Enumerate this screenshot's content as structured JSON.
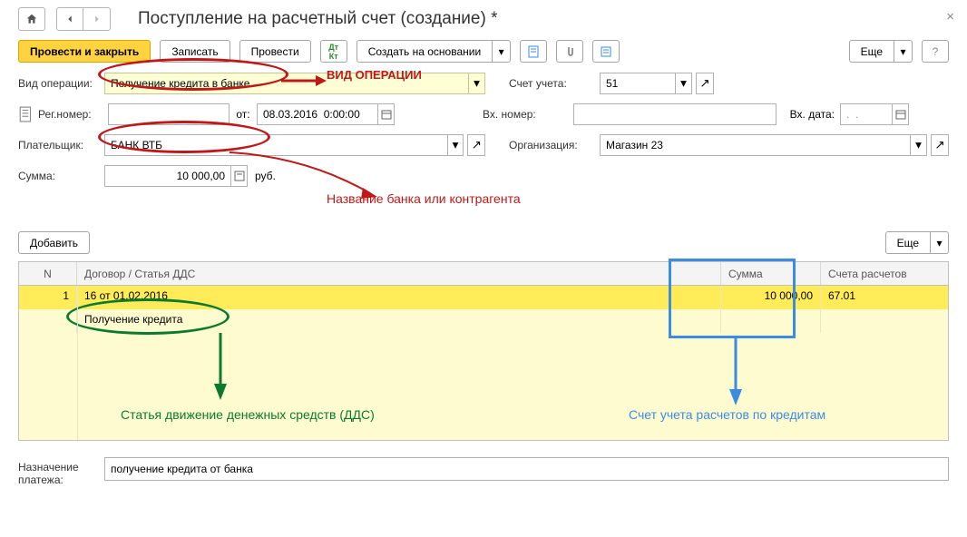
{
  "title": "Поступление на расчетный счет (создание) *",
  "actions": {
    "main": "Провести и закрыть",
    "save": "Записать",
    "post": "Провести",
    "create_based": "Создать на основании",
    "more": "Еще",
    "add": "Добавить"
  },
  "labels": {
    "operation_type": "Вид операции:",
    "account": "Счет учета:",
    "reg_number": "Рег.номер:",
    "from": "от:",
    "in_number": "Вх. номер:",
    "in_date": "Вх. дата:",
    "payer": "Плательщик:",
    "organization": "Организация:",
    "amount": "Сумма:",
    "currency": "руб.",
    "purpose": "Назначение платежа:"
  },
  "fields": {
    "operation_type": "Получение кредита в банке",
    "account": "51",
    "reg_number": "",
    "date": "08.03.2016  0:00:00",
    "in_number": "",
    "in_date": ".  .",
    "payer": "БАНК ВТБ",
    "organization": "Магазин 23",
    "amount": "10 000,00",
    "purpose": "получение кредита от банка"
  },
  "grid": {
    "headers": {
      "n": "N",
      "contract": "Договор / Статья ДДС",
      "sum": "Сумма",
      "accounts": "Счета расчетов"
    },
    "rows": [
      {
        "n": "1",
        "contract": "16 от 01.02.2016",
        "dds": "Получение кредита",
        "sum": "10 000,00",
        "account": "67.01"
      }
    ]
  },
  "annotations": {
    "op_type": "ВИД ОПЕРАЦИИ",
    "bank_name": "Название банка или контрагента",
    "dds": "Статья движение денежных средств (ДДС)",
    "credit_account": "Счет учета расчетов по кредитам"
  }
}
